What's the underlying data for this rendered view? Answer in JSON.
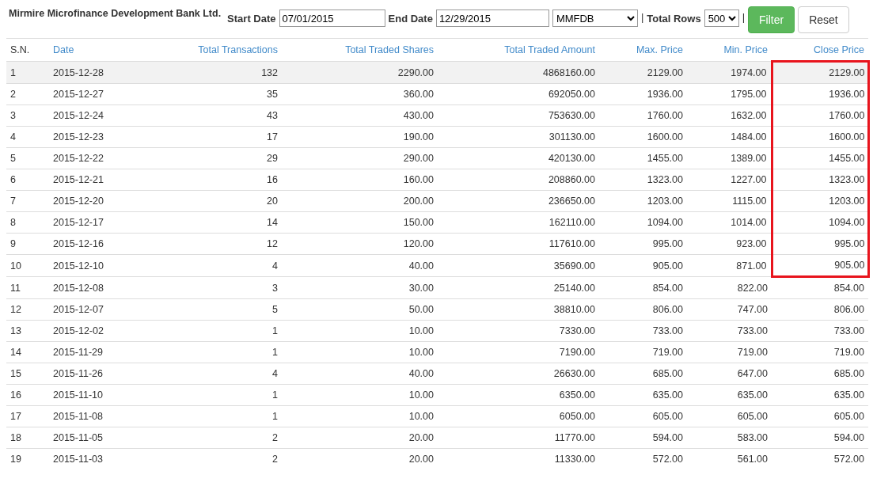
{
  "title": "Mirmire Microfinance Development Bank Ltd.",
  "filters": {
    "start_label": "Start Date",
    "start_value": "07/01/2015",
    "end_label": "End Date",
    "end_value": "12/29/2015",
    "symbol": "MMFDB",
    "separator": "|",
    "rows_label": "Total Rows",
    "rows_value": "500",
    "separator_2": "|",
    "filter_button": "Filter",
    "reset_button": "Reset"
  },
  "table": {
    "columns": [
      "S.N.",
      "Date",
      "Total Transactions",
      "Total Traded Shares",
      "Total Traded Amount",
      "Max. Price",
      "Min. Price",
      "Close Price"
    ],
    "rows": [
      {
        "cells": [
          "1",
          "2015-12-28",
          "132",
          "2290.00",
          "4868160.00",
          "2129.00",
          "1974.00",
          "2129.00"
        ],
        "selected": true,
        "outlined": true
      },
      {
        "cells": [
          "2",
          "2015-12-27",
          "35",
          "360.00",
          "692050.00",
          "1936.00",
          "1795.00",
          "1936.00"
        ],
        "selected": false,
        "outlined": true
      },
      {
        "cells": [
          "3",
          "2015-12-24",
          "43",
          "430.00",
          "753630.00",
          "1760.00",
          "1632.00",
          "1760.00"
        ],
        "selected": false,
        "outlined": true
      },
      {
        "cells": [
          "4",
          "2015-12-23",
          "17",
          "190.00",
          "301130.00",
          "1600.00",
          "1484.00",
          "1600.00"
        ],
        "selected": false,
        "outlined": true
      },
      {
        "cells": [
          "5",
          "2015-12-22",
          "29",
          "290.00",
          "420130.00",
          "1455.00",
          "1389.00",
          "1455.00"
        ],
        "selected": false,
        "outlined": true
      },
      {
        "cells": [
          "6",
          "2015-12-21",
          "16",
          "160.00",
          "208860.00",
          "1323.00",
          "1227.00",
          "1323.00"
        ],
        "selected": false,
        "outlined": true
      },
      {
        "cells": [
          "7",
          "2015-12-20",
          "20",
          "200.00",
          "236650.00",
          "1203.00",
          "1115.00",
          "1203.00"
        ],
        "selected": false,
        "outlined": true
      },
      {
        "cells": [
          "8",
          "2015-12-17",
          "14",
          "150.00",
          "162110.00",
          "1094.00",
          "1014.00",
          "1094.00"
        ],
        "selected": false,
        "outlined": true
      },
      {
        "cells": [
          "9",
          "2015-12-16",
          "12",
          "120.00",
          "117610.00",
          "995.00",
          "923.00",
          "995.00"
        ],
        "selected": false,
        "outlined": true
      },
      {
        "cells": [
          "10",
          "2015-12-10",
          "4",
          "40.00",
          "35690.00",
          "905.00",
          "871.00",
          "905.00"
        ],
        "selected": false,
        "outlined": true
      },
      {
        "cells": [
          "11",
          "2015-12-08",
          "3",
          "30.00",
          "25140.00",
          "854.00",
          "822.00",
          "854.00"
        ],
        "selected": false,
        "outlined": false
      },
      {
        "cells": [
          "12",
          "2015-12-07",
          "5",
          "50.00",
          "38810.00",
          "806.00",
          "747.00",
          "806.00"
        ],
        "selected": false,
        "outlined": false
      },
      {
        "cells": [
          "13",
          "2015-12-02",
          "1",
          "10.00",
          "7330.00",
          "733.00",
          "733.00",
          "733.00"
        ],
        "selected": false,
        "outlined": false
      },
      {
        "cells": [
          "14",
          "2015-11-29",
          "1",
          "10.00",
          "7190.00",
          "719.00",
          "719.00",
          "719.00"
        ],
        "selected": false,
        "outlined": false
      },
      {
        "cells": [
          "15",
          "2015-11-26",
          "4",
          "40.00",
          "26630.00",
          "685.00",
          "647.00",
          "685.00"
        ],
        "selected": false,
        "outlined": false
      },
      {
        "cells": [
          "16",
          "2015-11-10",
          "1",
          "10.00",
          "6350.00",
          "635.00",
          "635.00",
          "635.00"
        ],
        "selected": false,
        "outlined": false
      },
      {
        "cells": [
          "17",
          "2015-11-08",
          "1",
          "10.00",
          "6050.00",
          "605.00",
          "605.00",
          "605.00"
        ],
        "selected": false,
        "outlined": false
      },
      {
        "cells": [
          "18",
          "2015-11-05",
          "2",
          "20.00",
          "11770.00",
          "594.00",
          "583.00",
          "594.00"
        ],
        "selected": false,
        "outlined": false
      },
      {
        "cells": [
          "19",
          "2015-11-03",
          "2",
          "20.00",
          "11330.00",
          "572.00",
          "561.00",
          "572.00"
        ],
        "selected": false,
        "outlined": false
      }
    ]
  }
}
